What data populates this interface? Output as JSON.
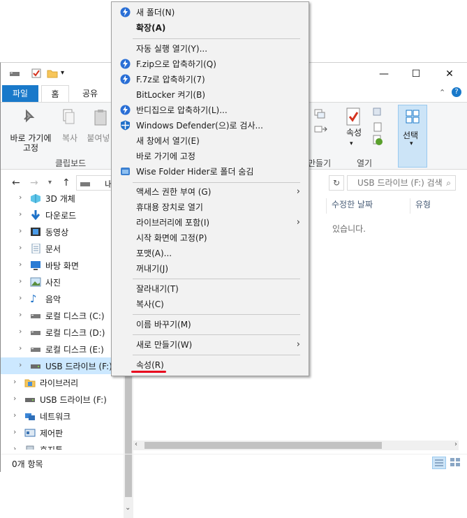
{
  "title_bar": {
    "quick_access_icons": [
      "drive-icon",
      "checkmark-doc-icon",
      "folder-icon",
      "dropdown-arrow-icon"
    ],
    "buttons": {
      "minimize": "—",
      "maximize": "☐",
      "close": "✕"
    }
  },
  "ribbon_tabs": [
    {
      "label": "파일"
    },
    {
      "label": "홈"
    },
    {
      "label": "공유"
    }
  ],
  "ribbon": {
    "pin_label": "바로 가기에\n고정",
    "copy_label": "복사",
    "paste_label": "붙여넣",
    "clipboard_group": "클립보드",
    "new_group_partial": "만들기",
    "open_group": "열기",
    "properties_label": "속성",
    "select_label": "선택"
  },
  "address": {
    "path_partial": "내",
    "search_placeholder": "USB 드라이브 (F:) 검색"
  },
  "columns": [
    {
      "label": "수정한 날짜"
    },
    {
      "label": "유형"
    }
  ],
  "empty_message_partial": "있습니다.",
  "tree": [
    {
      "label": "3D 개체",
      "icon": "3d-objects-icon"
    },
    {
      "label": "다운로드",
      "icon": "download-arrow-icon"
    },
    {
      "label": "동영상",
      "icon": "video-icon"
    },
    {
      "label": "문서",
      "icon": "document-icon"
    },
    {
      "label": "바탕 화면",
      "icon": "desktop-icon"
    },
    {
      "label": "사진",
      "icon": "picture-icon"
    },
    {
      "label": "음악",
      "icon": "music-icon"
    },
    {
      "label": "로컬 디스크 (C:)",
      "icon": "drive-icon"
    },
    {
      "label": "로컬 디스크 (D:)",
      "icon": "drive-icon"
    },
    {
      "label": "로컬 디스크 (E:)",
      "icon": "drive-icon"
    },
    {
      "label": "USB 드라이브 (F:)",
      "icon": "usb-drive-icon",
      "selected": true
    },
    {
      "label": "라이브러리",
      "icon": "library-icon"
    },
    {
      "label": "USB 드라이브 (F:)",
      "icon": "usb-drive-icon"
    },
    {
      "label": "네트워크",
      "icon": "network-icon"
    },
    {
      "label": "제어판",
      "icon": "control-panel-icon"
    },
    {
      "label": "휴지통",
      "icon": "recycle-bin-icon"
    }
  ],
  "status": {
    "item_count": "0개 항목"
  },
  "context_menu": {
    "items": [
      {
        "label": "새 폴더(N)",
        "icon": "bandizip-icon"
      },
      {
        "label": "확장(A)",
        "bold": true
      },
      {
        "label": "자동 실행 열기(Y)..."
      },
      {
        "label": "F.zip으로 압축하기(Q)",
        "icon": "bandizip-icon"
      },
      {
        "label": "F.7z로 압축하기(7)",
        "icon": "bandizip-icon"
      },
      {
        "label": "BitLocker 켜기(B)"
      },
      {
        "label": "반디집으로 압축하기(L)...",
        "icon": "bandizip-icon"
      },
      {
        "label": "Windows Defender(으)로 검사...",
        "icon": "defender-shield-icon"
      },
      {
        "label": "새 창에서 열기(E)"
      },
      {
        "label": "바로 가기에 고정"
      },
      {
        "label": "Wise Folder Hider로 폴더 숨김",
        "icon": "wise-folder-icon"
      },
      {
        "label": "액세스 권한 부여 (G)",
        "submenu": true
      },
      {
        "label": "휴대용 장치로 열기"
      },
      {
        "label": "라이브러리에 포함(I)",
        "submenu": true
      },
      {
        "label": "시작 화면에 고정(P)"
      },
      {
        "label": "포맷(A)..."
      },
      {
        "label": "꺼내기(J)"
      },
      {
        "label": "잘라내기(T)"
      },
      {
        "label": "복사(C)"
      },
      {
        "label": "이름 바꾸기(M)"
      },
      {
        "label": "새로 만들기(W)",
        "submenu": true
      },
      {
        "label": "속성(R)",
        "highlighted": true
      }
    ],
    "submenu_arrow": "›",
    "highlight_color": "#e8001c"
  },
  "colors": {
    "file_tab": "#1979ca",
    "selection": "#cce8ff",
    "menu_bg": "#f2f2f2",
    "accent_blue": "#1979ca"
  }
}
